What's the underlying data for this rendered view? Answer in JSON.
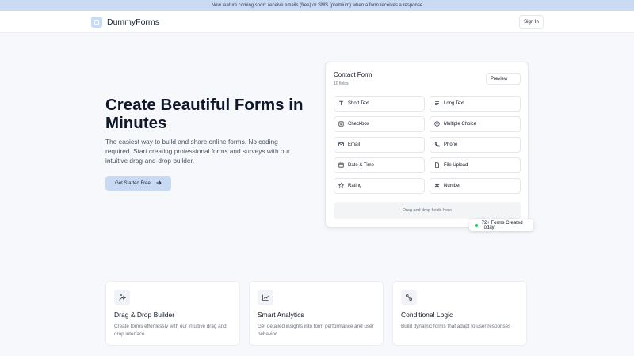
{
  "banner": {
    "text": "New feature coming soon: receive emails (free) or SMS (premium) when a form receives a response"
  },
  "header": {
    "brand": "DummyForms",
    "signin_label": "Sign In"
  },
  "hero": {
    "title": "Create Beautiful Forms in Minutes",
    "subtitle": "The easiest way to build and share online forms. No coding required. Start creating professional forms and surveys with our intuitive drag-and-drop builder.",
    "cta_label": "Get Started Free"
  },
  "form_card": {
    "title": "Contact Form",
    "count": "10 fields",
    "preview_label": "Preview",
    "fields": [
      {
        "label": "Short Text",
        "icon": "text-t-icon"
      },
      {
        "label": "Long Text",
        "icon": "paragraph-icon"
      },
      {
        "label": "Checkbox",
        "icon": "checkbox-icon"
      },
      {
        "label": "Multiple Choice",
        "icon": "radio-icon"
      },
      {
        "label": "Email",
        "icon": "mail-icon"
      },
      {
        "label": "Phone",
        "icon": "phone-icon"
      },
      {
        "label": "Date & Time",
        "icon": "calendar-icon"
      },
      {
        "label": "File Upload",
        "icon": "file-icon"
      },
      {
        "label": "Rating",
        "icon": "star-icon"
      },
      {
        "label": "Number",
        "icon": "hash-icon"
      }
    ],
    "dropzone": "Drag and drop fields here"
  },
  "badge": {
    "text": "72+ Forms Created Today!"
  },
  "features": [
    {
      "title": "Drag & Drop Builder",
      "desc": "Create forms effortlessly with our intuitive drag and drop interface",
      "icon": "sparkle-icon"
    },
    {
      "title": "Smart Analytics",
      "desc": "Get detailed insights into form performance and user behavior",
      "icon": "chart-icon"
    },
    {
      "title": "Conditional Logic",
      "desc": "Build dynamic forms that adapt to user responses",
      "icon": "route-icon"
    }
  ],
  "colors": {
    "banner_bg": "#c9daf2",
    "accent": "#c7d9f3",
    "status_green": "#22c55e"
  }
}
